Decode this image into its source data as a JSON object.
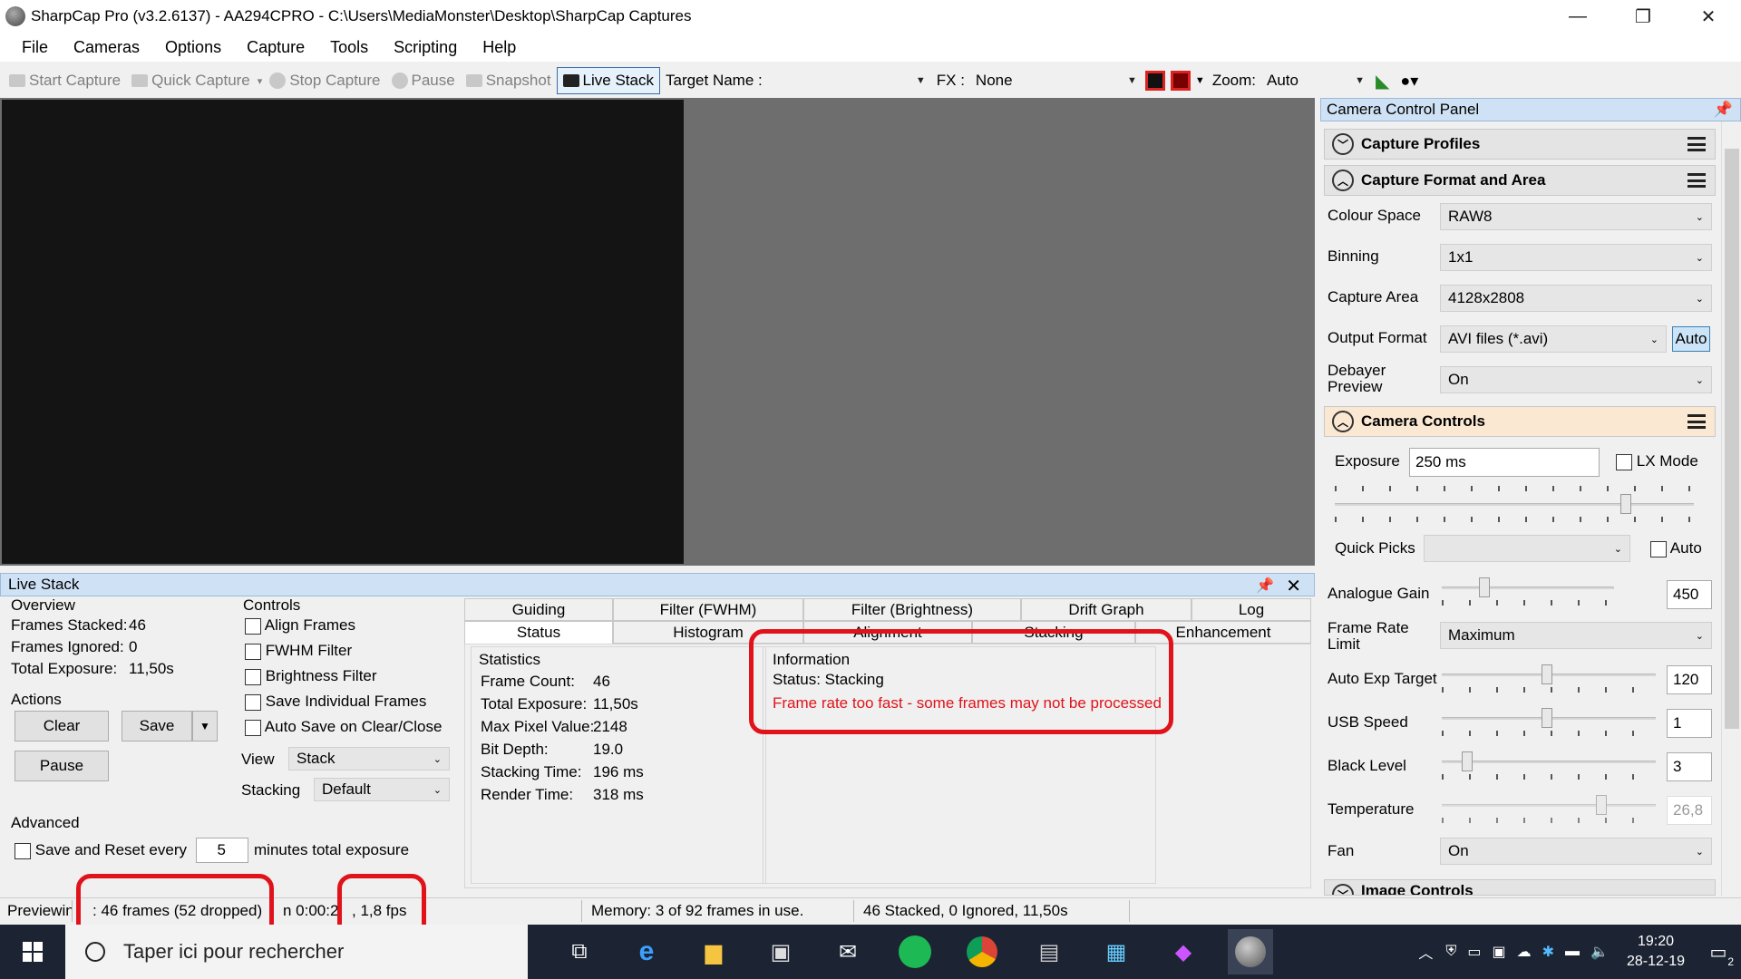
{
  "window": {
    "title": "SharpCap Pro (v3.2.6137) - AA294CPRO - C:\\Users\\MediaMonster\\Desktop\\SharpCap Captures",
    "minimize": "—",
    "maximize": "❐",
    "close": "✕"
  },
  "menu": [
    "File",
    "Cameras",
    "Options",
    "Capture",
    "Tools",
    "Scripting",
    "Help"
  ],
  "toolbar": {
    "start_capture": "Start Capture",
    "quick_capture": "Quick Capture",
    "stop_capture": "Stop Capture",
    "pause": "Pause",
    "snapshot": "Snapshot",
    "live_stack": "Live Stack",
    "target_name_label": "Target Name :",
    "target_name_value": "",
    "fx_label": "FX :",
    "fx_value": "None",
    "zoom_label": "Zoom:",
    "zoom_value": "Auto"
  },
  "camera_panel": {
    "title": "Camera Control Panel",
    "sections": {
      "capture_profiles": "Capture Profiles",
      "capture_format": "Capture Format and Area",
      "camera_controls": "Camera Controls",
      "image_controls": "Image Controls"
    },
    "format": {
      "colour_space_label": "Colour Space",
      "colour_space": "RAW8",
      "binning_label": "Binning",
      "binning": "1x1",
      "capture_area_label": "Capture Area",
      "capture_area": "4128x2808",
      "output_format_label": "Output Format",
      "output_format": "AVI files (*.avi)",
      "auto_button": "Auto",
      "debayer_label": "Debayer Preview",
      "debayer": "On"
    },
    "controls": {
      "exposure_label": "Exposure",
      "exposure": "250 ms",
      "lx_mode": "LX Mode",
      "quick_picks_label": "Quick Picks",
      "quick_picks": "",
      "auto_label": "Auto",
      "analogue_gain_label": "Analogue Gain",
      "analogue_gain": "450",
      "frame_rate_label": "Frame Rate Limit",
      "frame_rate": "Maximum",
      "auto_exp_label": "Auto Exp Target",
      "auto_exp": "120",
      "usb_speed_label": "USB Speed",
      "usb_speed": "1",
      "black_level_label": "Black Level",
      "black_level": "3",
      "temperature_label": "Temperature",
      "temperature": "26,8",
      "fan_label": "Fan",
      "fan": "On"
    },
    "slider_levels": {
      "exposure": 0.82,
      "analogue_gain": 0.23,
      "auto_exp": 0.49,
      "usb_speed": 0.49,
      "black_level": 0.1,
      "temperature": 0.76
    }
  },
  "live_stack": {
    "title": "Live Stack",
    "overview_label": "Overview",
    "frames_stacked_label": "Frames Stacked:",
    "frames_stacked": "46",
    "frames_ignored_label": "Frames Ignored:",
    "frames_ignored": "0",
    "total_exposure_label": "Total Exposure:",
    "total_exposure": "11,50s",
    "actions_label": "Actions",
    "clear": "Clear",
    "save": "Save",
    "pause": "Pause",
    "controls_label": "Controls",
    "align_frames": "Align Frames",
    "fwhm_filter": "FWHM Filter",
    "brightness_filter": "Brightness Filter",
    "save_individual": "Save Individual Frames",
    "auto_save": "Auto Save on Clear/Close",
    "view_label": "View",
    "view_value": "Stack",
    "stacking_label": "Stacking",
    "stacking_value": "Default",
    "advanced_label": "Advanced",
    "save_reset_label": "Save and Reset every",
    "save_reset_value": "5",
    "save_reset_suffix": "minutes total exposure",
    "tabs_top": [
      "Guiding",
      "Filter (FWHM)",
      "Filter (Brightness)",
      "Drift Graph",
      "Log"
    ],
    "tabs_bottom": [
      "Status",
      "Histogram",
      "Alignment",
      "Stacking",
      "Enhancement"
    ],
    "statistics": {
      "label": "Statistics",
      "rows": [
        {
          "k": "Frame Count:",
          "v": "46"
        },
        {
          "k": "Total Exposure:",
          "v": "11,50s"
        },
        {
          "k": "Max Pixel Value:",
          "v": "2148"
        },
        {
          "k": "Bit Depth:",
          "v": "19.0"
        },
        {
          "k": "Stacking Time:",
          "v": "196 ms"
        },
        {
          "k": "Render Time:",
          "v": "318 ms"
        }
      ]
    },
    "information": {
      "label": "Information",
      "status": "Status: Stacking",
      "warning": "Frame rate too fast - some frames may not be processed",
      "warning_color": "#e0131a"
    }
  },
  "statusbar": {
    "previewing": "Previewin",
    "frames": ": 46 frames (52 dropped)",
    "time": "n 0:00:24",
    "fps": ", 1,8 fps",
    "memory": "Memory: 3 of 92 frames in use.",
    "stack_summary": "46 Stacked, 0 Ignored, 11,50s"
  },
  "taskbar": {
    "search_placeholder": "Taper ici pour rechercher",
    "time": "19:20",
    "date": "28-12-19",
    "notification_count": "2"
  }
}
